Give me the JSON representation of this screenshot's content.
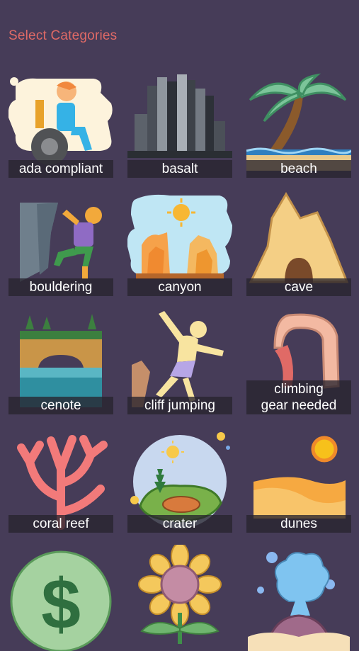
{
  "header": {
    "title": "Select Categories"
  },
  "categories": [
    {
      "label": "ada compliant",
      "icon": "wheelchair-icon"
    },
    {
      "label": "basalt",
      "icon": "basalt-columns-icon"
    },
    {
      "label": "beach",
      "icon": "palm-tree-icon"
    },
    {
      "label": "bouldering",
      "icon": "climber-icon"
    },
    {
      "label": "canyon",
      "icon": "canyon-icon"
    },
    {
      "label": "cave",
      "icon": "cave-icon"
    },
    {
      "label": "cenote",
      "icon": "cenote-icon"
    },
    {
      "label": "cliff jumping",
      "icon": "jumper-icon"
    },
    {
      "label": "climbing gear needed",
      "label_line1": "climbing",
      "label_line2": "gear needed",
      "icon": "carabiner-icon"
    },
    {
      "label": "coral reef",
      "icon": "coral-icon"
    },
    {
      "label": "crater",
      "icon": "crater-icon"
    },
    {
      "label": "dunes",
      "icon": "dunes-icon"
    },
    {
      "label": "",
      "icon": "dollar-icon"
    },
    {
      "label": "",
      "icon": "sunflower-icon"
    },
    {
      "label": "",
      "icon": "geyser-icon"
    }
  ]
}
